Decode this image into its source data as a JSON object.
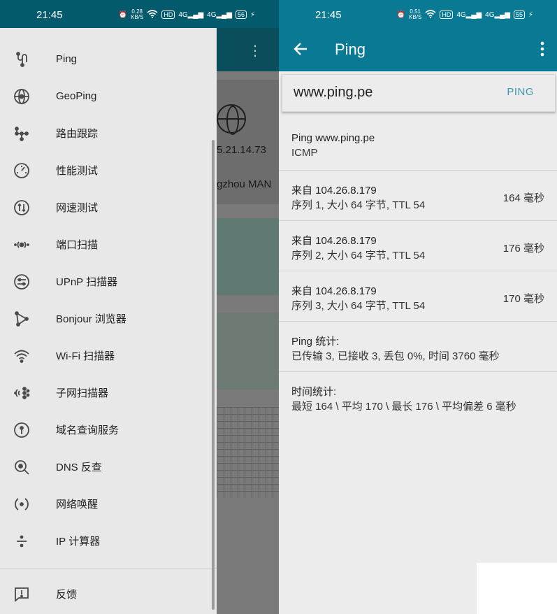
{
  "left_screen": {
    "status_bar": {
      "time": "21:45",
      "speed": "0.28",
      "speed_unit": "KB/S",
      "hd": "HD",
      "net1": "4G",
      "net2": "4G",
      "battery": "56"
    },
    "background_app": {
      "ip_fragment": "5.21.14.73",
      "location_fragment": "gzhou MAN"
    },
    "menu_items": [
      {
        "id": "ping",
        "label": "Ping",
        "icon": "ping-icon"
      },
      {
        "id": "geoping",
        "label": "GeoPing",
        "icon": "geoping-icon"
      },
      {
        "id": "traceroute",
        "label": "路由跟踪",
        "icon": "traceroute-icon"
      },
      {
        "id": "performance",
        "label": "性能测试",
        "icon": "speedometer-icon"
      },
      {
        "id": "speedtest",
        "label": "网速测试",
        "icon": "speedtest-icon"
      },
      {
        "id": "portscan",
        "label": "端口扫描",
        "icon": "port-scan-icon"
      },
      {
        "id": "upnp",
        "label": "UPnP 扫描器",
        "icon": "upnp-icon"
      },
      {
        "id": "bonjour",
        "label": "Bonjour 浏览器",
        "icon": "bonjour-icon"
      },
      {
        "id": "wifi",
        "label": "Wi-Fi 扫描器",
        "icon": "wifi-icon"
      },
      {
        "id": "subnet",
        "label": "子网扫描器",
        "icon": "subnet-icon"
      },
      {
        "id": "whois",
        "label": "域名查询服务",
        "icon": "whois-icon"
      },
      {
        "id": "dns",
        "label": "DNS 反查",
        "icon": "dns-lookup-icon"
      },
      {
        "id": "wol",
        "label": "网络唤醒",
        "icon": "wake-on-lan-icon"
      },
      {
        "id": "ipcalc",
        "label": "IP 计算器",
        "icon": "divide-icon"
      }
    ],
    "feedback": {
      "label": "反馈",
      "icon": "feedback-icon"
    }
  },
  "right_screen": {
    "status_bar": {
      "time": "21:45",
      "speed": "0.51",
      "speed_unit": "KB/S",
      "hd": "HD",
      "net1": "4G",
      "net2": "4G",
      "battery": "55"
    },
    "toolbar": {
      "title": "Ping"
    },
    "search": {
      "value": "www.ping.pe",
      "button": "PING"
    },
    "results": [
      {
        "line1": "Ping www.ping.pe",
        "line2": "ICMP",
        "right": ""
      },
      {
        "line1": "来自 104.26.8.179",
        "line2": "序列 1, 大小 64 字节, TTL 54",
        "right": "164 毫秒"
      },
      {
        "line1": "来自 104.26.8.179",
        "line2": "序列 2, 大小 64 字节, TTL 54",
        "right": "176 毫秒"
      },
      {
        "line1": "来自 104.26.8.179",
        "line2": "序列 3, 大小 64 字节, TTL 54",
        "right": "170 毫秒"
      },
      {
        "line1": "Ping 统计:",
        "line2": "已传输 3, 已接收 3, 丢包 0%, 时间 3760 毫秒",
        "right": ""
      },
      {
        "line1": "时间统计:",
        "line2": "最短 164 \\ 平均 170 \\ 最长 176 \\ 平均偏差 6 毫秒",
        "right": ""
      }
    ]
  },
  "colors": {
    "accent": "#0a7a94",
    "link": "#3f97aa",
    "drawer_bg": "#e8e8e8"
  }
}
